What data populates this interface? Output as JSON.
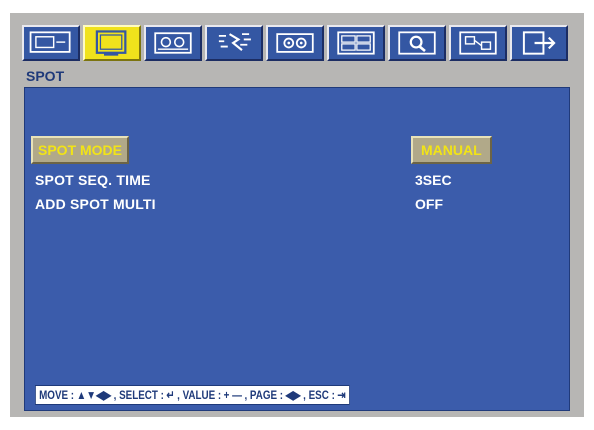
{
  "menu": {
    "tabs": [
      {
        "icon": "monitor-icon"
      },
      {
        "icon": "spot-screen-icon",
        "active": true
      },
      {
        "icon": "camera-icon"
      },
      {
        "icon": "motion-icon"
      },
      {
        "icon": "settings-icon"
      },
      {
        "icon": "multiscreen-icon"
      },
      {
        "icon": "search-icon"
      },
      {
        "icon": "network-icon"
      },
      {
        "icon": "exit-icon"
      }
    ],
    "section_title": "SPOT"
  },
  "settings": [
    {
      "label": "SPOT MODE",
      "value": "MANUAL",
      "selected": true
    },
    {
      "label": "SPOT SEQ. TIME",
      "value": "3SEC"
    },
    {
      "label": "ADD SPOT MULTI",
      "value": "OFF"
    }
  ],
  "help_bar": {
    "move": "MOVE :",
    "move_keys": "▲▼◀▶",
    "select": ", SELECT :",
    "select_key": "↵",
    "value": ", VALUE :",
    "value_keys": "+ —",
    "page": ", PAGE :",
    "page_keys": "◀▶",
    "esc": ", ESC :",
    "esc_key": "⇥"
  },
  "colors": {
    "panel_bg": "#3b5cab",
    "highlight_text": "#f2e416",
    "frame_bg": "#b7b6b4"
  }
}
